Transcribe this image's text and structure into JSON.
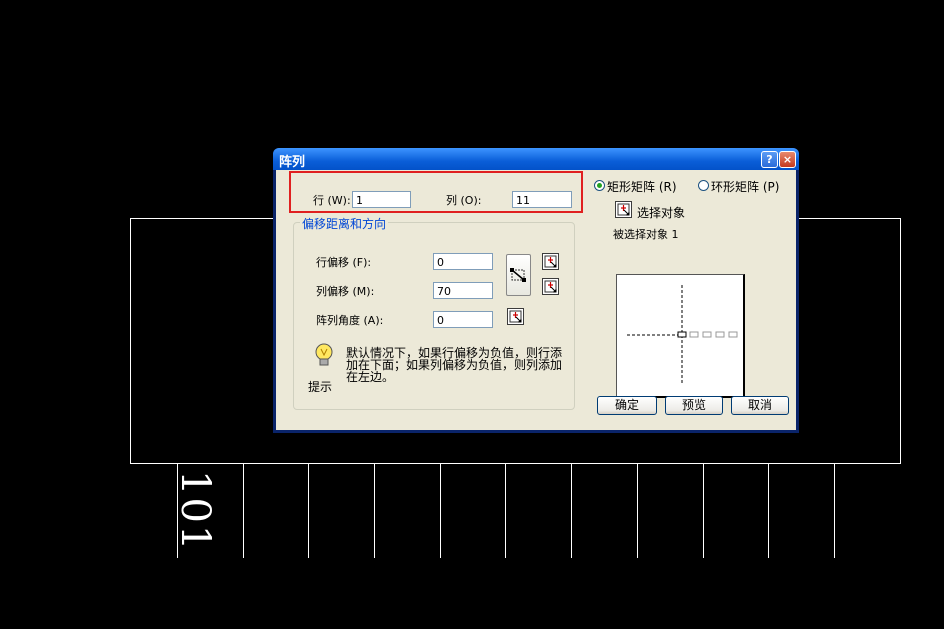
{
  "cad": {
    "text": "101"
  },
  "dialog": {
    "title": "阵列",
    "help_button": "?",
    "close_button": "×",
    "rows": {
      "label": "行 (W):",
      "value": "1"
    },
    "columns": {
      "label": "列 (O):",
      "value": "11"
    },
    "offset_group": {
      "title": "偏移距离和方向",
      "row_offset": {
        "label": "行偏移 (F):",
        "value": "0"
      },
      "column_offset": {
        "label": "列偏移 (M):",
        "value": "70"
      },
      "angle": {
        "label": "阵列角度 (A):",
        "value": "0"
      }
    },
    "tip": {
      "text_line1": "默认情况下，如果行偏移为负值，则行添",
      "text_line2": "加在下面；如果列偏移为负值，则列添加",
      "text_line3": "在左边。",
      "label": "提示"
    },
    "mode": {
      "rect": "矩形矩阵 (R)",
      "polar": "环形矩阵 (P)",
      "selected": "rect"
    },
    "select_objects": "选择对象",
    "selected_count": "被选择对象 1",
    "buttons": {
      "ok": "确定",
      "preview": "预览",
      "cancel": "取消"
    }
  }
}
